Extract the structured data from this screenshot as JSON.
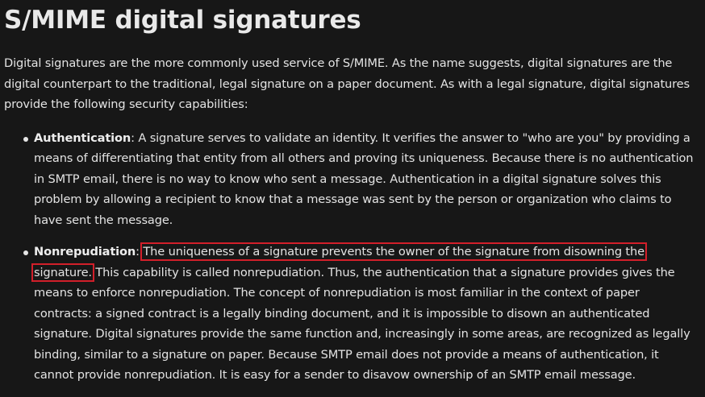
{
  "article": {
    "title": "S/MIME digital signatures",
    "intro": "Digital signatures are the more commonly used service of S/MIME. As the name suggests, digital signatures are the digital counterpart to the traditional, legal signature on a paper document. As with a legal signature, digital signatures provide the following security capabilities:",
    "capabilities": [
      {
        "term": "Authentication",
        "separator": ": ",
        "text": "A signature serves to validate an identity. It verifies the answer to \"who are you\" by providing a means of differentiating that entity from all others and proving its uniqueness. Because there is no authentication in SMTP email, there is no way to know who sent a message. Authentication in a digital signature solves this problem by allowing a recipient to know that a message was sent by the person or organization who claims to have sent the message."
      },
      {
        "term": "Nonrepudiation",
        "separator": ": ",
        "highlighted": "The uniqueness of a signature prevents the owner of the signature from disowning the signature.",
        "text": " This capability is called nonrepudiation. Thus, the authentication that a signature provides gives the means to enforce nonrepudiation. The concept of nonrepudiation is most familiar in the context of paper contracts: a signed contract is a legally binding document, and it is impossible to disown an authenticated signature. Digital signatures provide the same function and, increasingly in some areas, are recognized as legally binding, similar to a signature on paper. Because SMTP email does not provide a means of authentication, it cannot provide nonrepudiation. It is easy for a sender to disavow ownership of an SMTP email message."
      }
    ]
  },
  "colors": {
    "background": "#171717",
    "text": "#e3e3e3",
    "highlight_border": "#d21f2a"
  }
}
